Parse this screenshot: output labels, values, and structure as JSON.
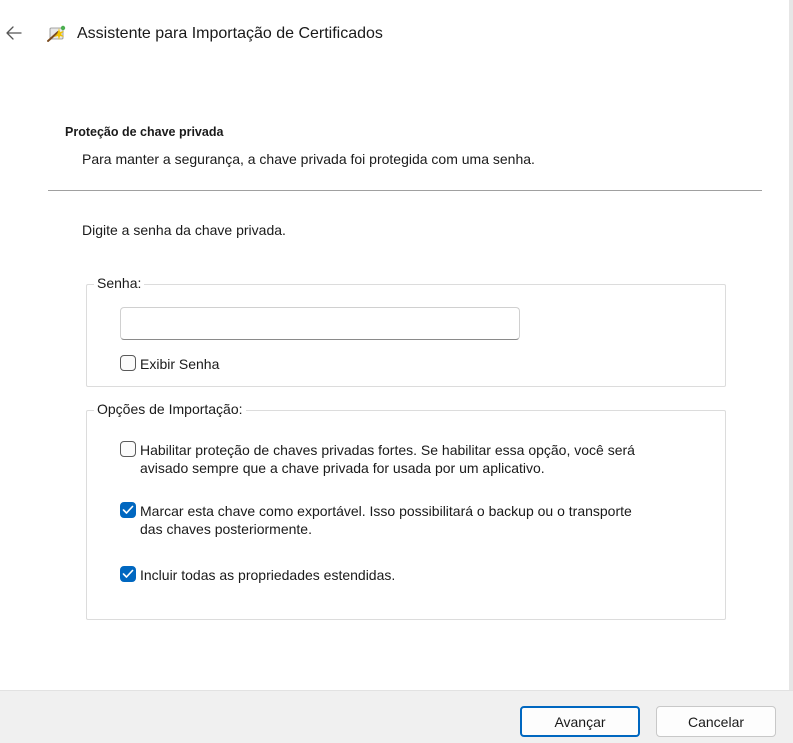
{
  "window": {
    "title": "Assistente para Importação de Certificados",
    "back_icon": "back-arrow-icon",
    "title_icon": "certificate-wizard-icon"
  },
  "section": {
    "title": "Proteção de chave privada",
    "subtitle": "Para manter a segurança, a chave privada foi protegida com uma senha."
  },
  "prompt": "Digite a senha da chave privada.",
  "password_group": {
    "label": "Senha:",
    "value": "",
    "placeholder": "",
    "show_password": {
      "label": "Exibir Senha",
      "checked": false
    }
  },
  "import_options": {
    "label": "Opções de Importação:",
    "options": [
      {
        "label_line1": "Habilitar proteção de chaves privadas fortes. Se habilitar essa opção, você será",
        "label_line2": "avisado sempre que a chave privada for usada por um aplicativo.",
        "checked": false
      },
      {
        "label_line1": "Marcar esta chave como exportável. Isso possibilitará o backup ou o transporte",
        "label_line2": "das chaves posteriormente.",
        "checked": true
      },
      {
        "label_line1": "Incluir todas as propriedades estendidas.",
        "checked": true
      }
    ]
  },
  "footer": {
    "next_label": "Avançar",
    "cancel_label": "Cancelar"
  },
  "colors": {
    "accent": "#0067c0",
    "footer_bg": "#f0f0f0",
    "divider": "#a0a0a0"
  }
}
